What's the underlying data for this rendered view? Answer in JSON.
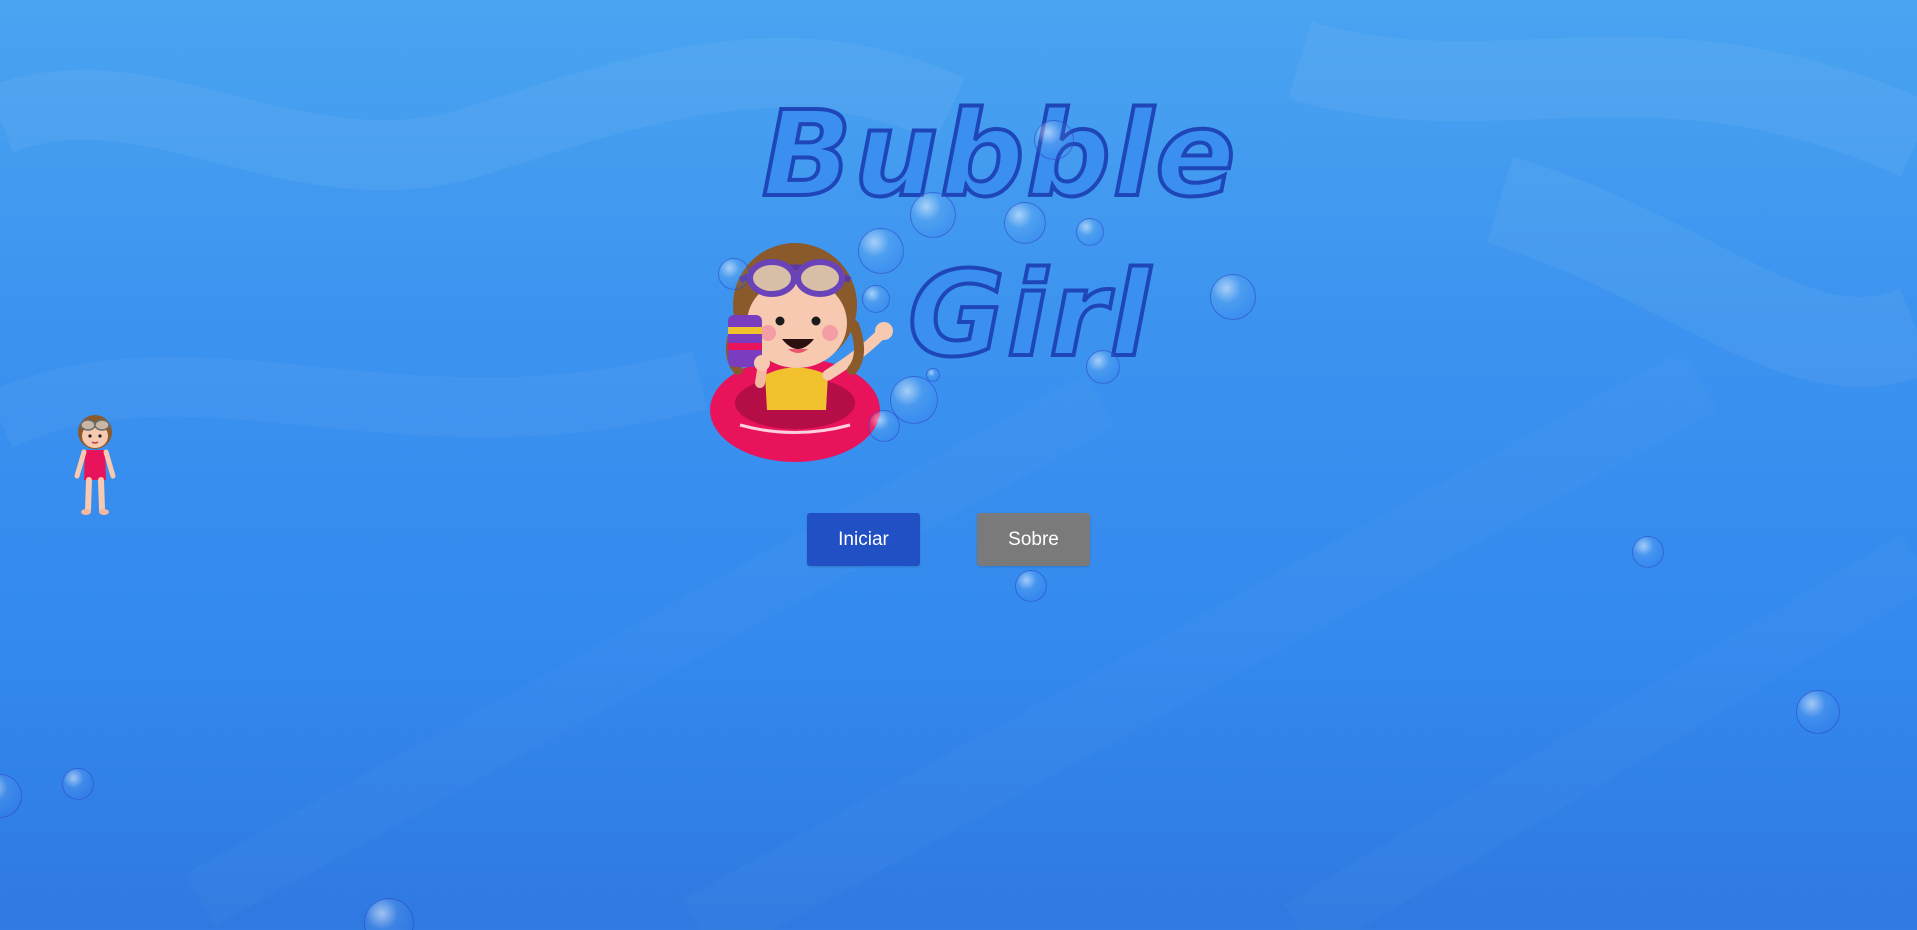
{
  "game": {
    "title_line_1": "Bubble",
    "title_line_2": "Girl",
    "buttons": {
      "start_label": "Iniciar",
      "about_label": "Sobre"
    }
  },
  "colors": {
    "background_top": "#4aa4f1",
    "background_bottom": "#2f79e1",
    "title_fill": "#3b8ff0",
    "title_outline": "#1f46b8",
    "start_button": "#2150c4",
    "about_button": "#7a7a7a",
    "swim_ring": "#e8135a"
  },
  "icons": {
    "logo_character": "girl-with-goggles-in-swim-ring",
    "player": "girl-in-swimsuit",
    "decoration": "bubble"
  }
}
